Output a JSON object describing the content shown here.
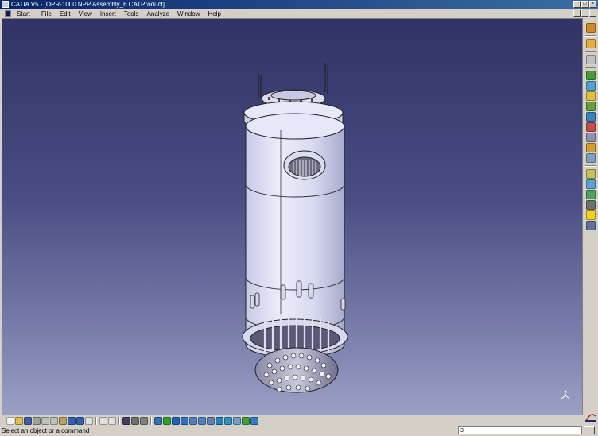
{
  "window": {
    "title": "CATIA V5 - [OPR-1000 NPP Assembly_6.CATProduct]"
  },
  "menu": {
    "start": "Start",
    "items": [
      "File",
      "Edit",
      "View",
      "Insert",
      "Tools",
      "Analyze",
      "Window",
      "Help"
    ]
  },
  "right_toolbar": {
    "icons": [
      {
        "name": "part-design-icon",
        "color": "#d08a2a"
      },
      {
        "name": "sketch-icon",
        "color": "#e0b040"
      },
      {
        "name": "assembly-icon",
        "color": "#c0c0c0"
      },
      {
        "name": "product-icon",
        "color": "#4a9a3a"
      },
      {
        "name": "constraint-icon",
        "color": "#50a0d0"
      },
      {
        "name": "catalog-icon",
        "color": "#e0c040"
      },
      {
        "name": "move-icon",
        "color": "#60a040"
      },
      {
        "name": "explode-icon",
        "color": "#3a80c0"
      },
      {
        "name": "clash-icon",
        "color": "#c05050"
      },
      {
        "name": "section-icon",
        "color": "#9090b0"
      },
      {
        "name": "measure-icon",
        "color": "#d0a030"
      },
      {
        "name": "annotation-icon",
        "color": "#80a0c0"
      },
      {
        "name": "bom-icon",
        "color": "#c0c060"
      },
      {
        "name": "scene-icon",
        "color": "#60a0d0"
      },
      {
        "name": "analysis-icon",
        "color": "#50a060"
      },
      {
        "name": "material-icon",
        "color": "#707070"
      },
      {
        "name": "lightbulb-icon",
        "color": "#f0d020"
      },
      {
        "name": "publish-icon",
        "color": "#6070a0"
      }
    ]
  },
  "bottom_toolbar": {
    "groups": [
      [
        {
          "name": "new-icon",
          "color": "#f0f0f0"
        },
        {
          "name": "open-icon",
          "color": "#e0c050"
        },
        {
          "name": "save-icon",
          "color": "#4060a0"
        },
        {
          "name": "print-icon",
          "color": "#a0a0a0"
        },
        {
          "name": "cut-icon",
          "color": "#c0c0c0"
        },
        {
          "name": "copy-icon",
          "color": "#c0c0c0"
        },
        {
          "name": "paste-icon",
          "color": "#c0a060"
        },
        {
          "name": "undo-icon",
          "color": "#3060b0"
        },
        {
          "name": "redo-icon",
          "color": "#3060b0"
        },
        {
          "name": "help-icon",
          "color": "#e0e0e0"
        }
      ],
      [
        {
          "name": "formula-icon",
          "color": "#e0e0e0"
        },
        {
          "name": "knowledge-icon",
          "color": "#e0e0e0"
        }
      ],
      [
        {
          "name": "tree-icon",
          "color": "#404060"
        },
        {
          "name": "catalog-browser-icon",
          "color": "#707070"
        },
        {
          "name": "properties-icon",
          "color": "#808080"
        }
      ],
      [
        {
          "name": "fly-mode-icon",
          "color": "#3070c0"
        },
        {
          "name": "fit-all-icon",
          "color": "#30a030"
        },
        {
          "name": "pan-icon",
          "color": "#2060c0"
        },
        {
          "name": "rotate-icon",
          "color": "#3070c0"
        },
        {
          "name": "zoom-in-icon",
          "color": "#5080c0"
        },
        {
          "name": "zoom-out-icon",
          "color": "#5080c0"
        },
        {
          "name": "normal-view-icon",
          "color": "#6080b0"
        },
        {
          "name": "iso-view-icon",
          "color": "#2080c0"
        },
        {
          "name": "render-style-icon",
          "color": "#3090c0"
        },
        {
          "name": "hide-show-icon",
          "color": "#70a0d0"
        },
        {
          "name": "swap-space-icon",
          "color": "#40a040"
        },
        {
          "name": "view-mode-icon",
          "color": "#3080c0"
        }
      ]
    ]
  },
  "status": {
    "message": "Select an object or a command",
    "command_value": "3"
  }
}
